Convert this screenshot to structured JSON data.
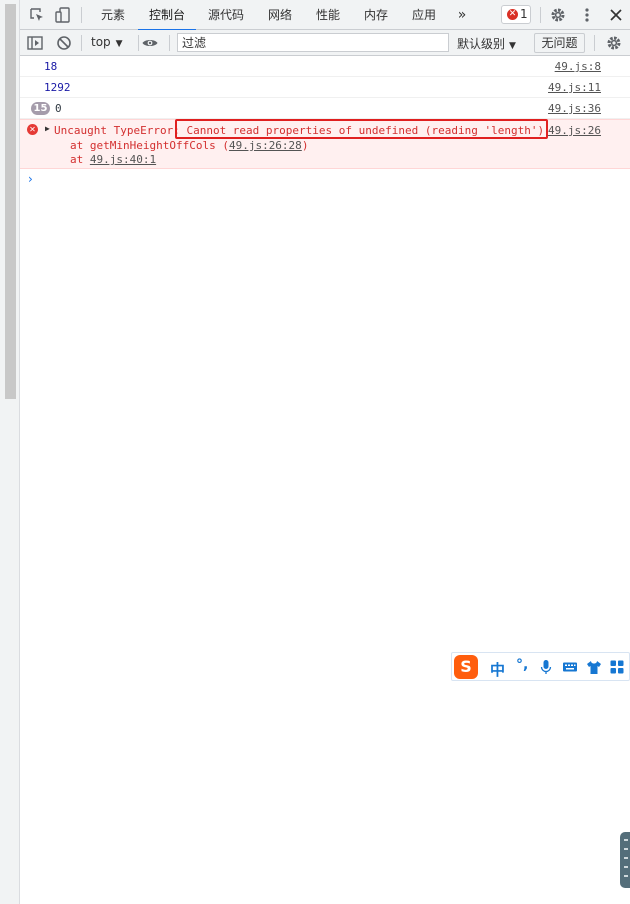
{
  "tabs": [
    {
      "label": "元素",
      "active": false
    },
    {
      "label": "控制台",
      "active": true
    },
    {
      "label": "源代码",
      "active": false
    },
    {
      "label": "网络",
      "active": false
    },
    {
      "label": "性能",
      "active": false
    },
    {
      "label": "内存",
      "active": false
    },
    {
      "label": "应用",
      "active": false
    }
  ],
  "more_tabs_glyph": "»",
  "error_badge_count": "1",
  "toolbar": {
    "context": "top",
    "filter_placeholder": "过滤",
    "levels": "默认级别",
    "issues": "无问题"
  },
  "logs": [
    {
      "value": "18",
      "source": "49.js:8"
    },
    {
      "value": "1292",
      "source": "49.js:11"
    },
    {
      "repeat": "15",
      "value": "0",
      "source": "49.js:36"
    }
  ],
  "error": {
    "message": "Uncaught TypeError: Cannot read properties of undefined (reading 'length')",
    "source": "49.js:26",
    "stack1_prefix": "at getMinHeightOffCols (",
    "stack1_link": "49.js:26:28",
    "stack1_suffix": ")",
    "stack2_prefix": "at ",
    "stack2_link": "49.js:40:1"
  },
  "prompt": "›",
  "ime": {
    "logo": "S",
    "mode": "中",
    "punct": "°,"
  },
  "colors": {
    "accent": "#1a73e8",
    "error": "#d32f2f",
    "error_bg": "#fff0f0",
    "highlight": "#e02020",
    "ime": "#ff5e0e"
  },
  "icons": [
    "inspect-icon",
    "device-toolbar-icon",
    "error-circle-icon",
    "settings-gear-icon",
    "more-vert-icon",
    "close-icon",
    "sidebar-toggle-icon",
    "clear-console-icon",
    "eye-icon",
    "console-settings-icon",
    "microphone-icon",
    "keyboard-icon",
    "skin-shirt-icon",
    "toolbox-grid-icon"
  ]
}
